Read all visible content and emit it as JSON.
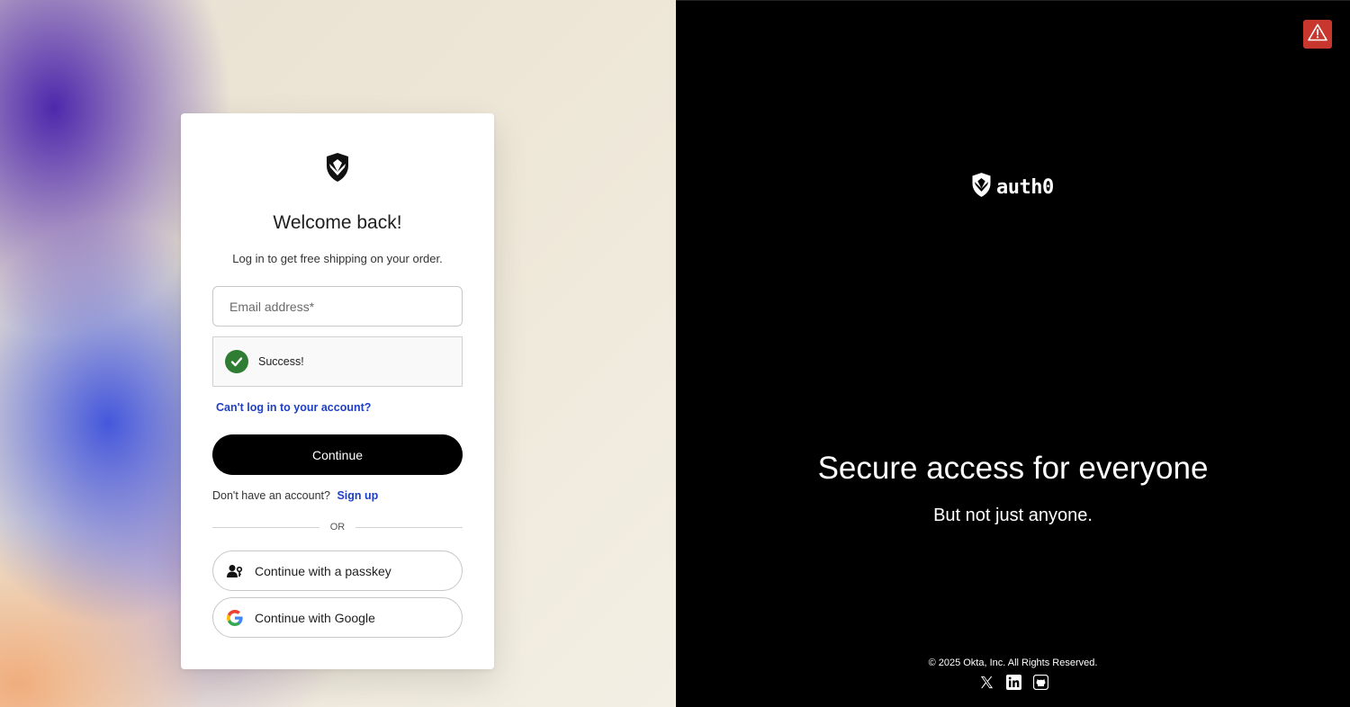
{
  "login_card": {
    "title": "Welcome back!",
    "subtitle": "Log in to get free shipping on your order.",
    "email_placeholder": "Email address*",
    "email_value": "",
    "captcha_status": "Success!",
    "cant_login_link": "Can't log in to your account?",
    "continue_label": "Continue",
    "signup_prompt": "Don't have an account?",
    "signup_link": "Sign up",
    "divider_text": "OR",
    "passkey_label": "Continue with a passkey",
    "google_label": "Continue with Google"
  },
  "promo": {
    "brand": "auth0",
    "headline": "Secure access for everyone",
    "subheadline": "But not just anyone.",
    "copyright": "© 2025 Okta, Inc. All Rights Reserved."
  },
  "icons": {
    "logo": "shield-logo-icon",
    "captcha": "check-circle-icon",
    "passkey": "passkey-user-icon",
    "google": "google-icon",
    "social": [
      "x-icon",
      "linkedin-icon",
      "github-icon"
    ],
    "warning": "warning-icon"
  },
  "colors": {
    "accent_link": "#1f3fc4",
    "primary_button": "#000000",
    "success": "#2e7d32",
    "warning": "#c8372d",
    "right_panel_bg": "#000000"
  }
}
